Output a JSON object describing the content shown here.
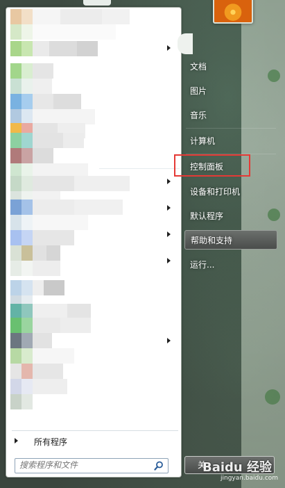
{
  "right_menu": {
    "items": [
      {
        "key": "documents",
        "label": "文档"
      },
      {
        "key": "pictures",
        "label": "图片"
      },
      {
        "key": "music",
        "label": "音乐"
      },
      {
        "key": "computer",
        "label": "计算机"
      },
      {
        "key": "control_panel",
        "label": "控制面板"
      },
      {
        "key": "devices_printers",
        "label": "设备和打印机"
      },
      {
        "key": "default_programs",
        "label": "默认程序"
      },
      {
        "key": "help_support",
        "label": "帮助和支持"
      },
      {
        "key": "run",
        "label": "运行..."
      }
    ],
    "shutdown_label": "关"
  },
  "left_menu": {
    "all_programs_label": "所有程序",
    "search_placeholder": "搜索程序和文件"
  },
  "watermark": {
    "brand": "Baidu 经验",
    "url": "jingyan.baidu.com"
  },
  "colors": {
    "highlight_border": "#e53935",
    "panel_bg": "#ffffff",
    "accent_green": "#5fa25b"
  }
}
